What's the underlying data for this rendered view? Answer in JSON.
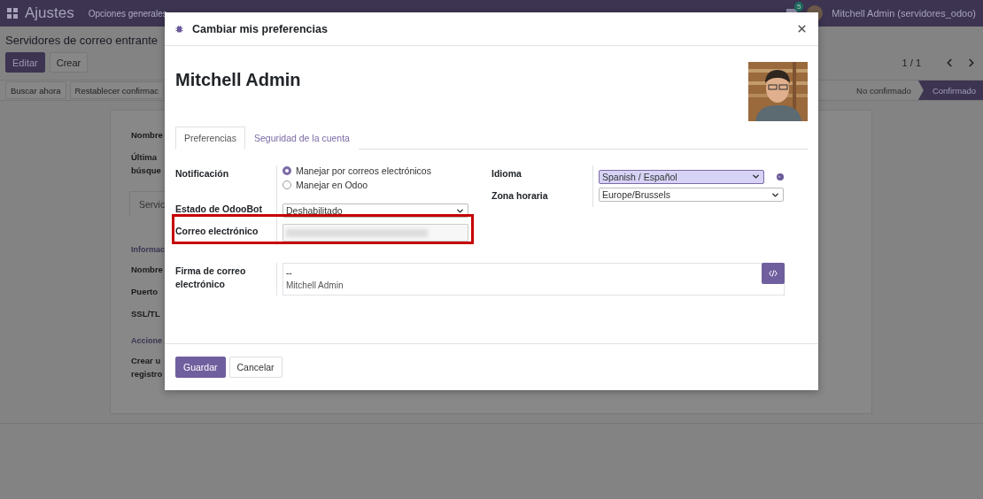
{
  "navbar": {
    "app_title": "Ajustes",
    "menu": [
      "Opciones generales"
    ],
    "badge": "5",
    "user": "Mitchell Admin (servidores_odoo)"
  },
  "breadcrumb": "Servidores de correo entrante",
  "actions": [
    {
      "label": "Editar",
      "primary": true
    },
    {
      "label": "Crear",
      "primary": false
    }
  ],
  "pager": "1 / 1",
  "header_buttons": [
    "Buscar ahora",
    "Restablecer confirmac"
  ],
  "status": [
    {
      "label": "No confirmado",
      "selected": false
    },
    {
      "label": "Confirmado",
      "selected": true
    }
  ],
  "sheet": {
    "rows": [
      {
        "kind": "field",
        "lines": [
          "Nombre"
        ]
      },
      {
        "kind": "field",
        "lines": [
          "Última",
          "búsque"
        ]
      },
      {
        "kind": "tab",
        "lines": [
          "Servic"
        ]
      },
      {
        "kind": "section",
        "lines": [
          "Informac"
        ]
      },
      {
        "kind": "field",
        "lines": [
          "Nombre"
        ]
      },
      {
        "kind": "field",
        "lines": [
          "Puerto"
        ]
      },
      {
        "kind": "field",
        "lines": [
          "SSL/TL"
        ]
      },
      {
        "kind": "section",
        "lines": [
          "Accione"
        ]
      },
      {
        "kind": "field",
        "lines": [
          "Crear u",
          "registro"
        ]
      }
    ]
  },
  "dialog": {
    "title": "Cambiar mis preferencias",
    "name": "Mitchell Admin",
    "tabs": [
      {
        "label": "Preferencias",
        "selected": true
      },
      {
        "label": "Seguridad de la cuenta",
        "selected": false
      }
    ],
    "notification": {
      "label": "Notificación",
      "options": [
        {
          "label": "Manejar por correos electrónicos",
          "selected": true
        },
        {
          "label": "Manejar en Odoo",
          "selected": false
        }
      ]
    },
    "odoobot": {
      "label": "Estado de OdooBot",
      "value": "Deshabilitado"
    },
    "email": {
      "label": "Correo electrónico",
      "highlighted": true
    },
    "language": {
      "label": "Idioma",
      "value": "Spanish / Español",
      "focused": true
    },
    "timezone": {
      "label": "Zona horaria",
      "value": "Europe/Brussels"
    },
    "signature": {
      "label": "Firma de correo electrónico",
      "lines": [
        "--",
        "Mitchell Admin"
      ]
    },
    "buttons": [
      {
        "label": "Guardar",
        "primary": true
      },
      {
        "label": "Cancelar",
        "primary": false
      }
    ]
  }
}
